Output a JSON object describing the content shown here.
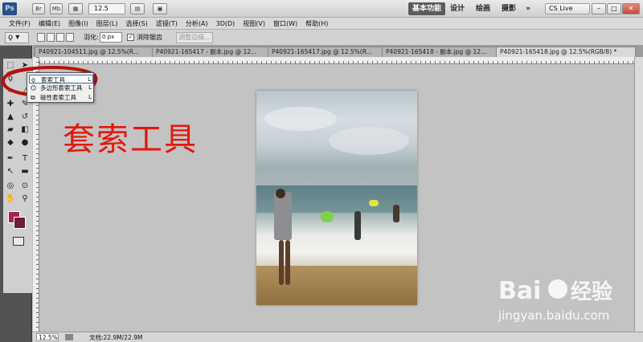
{
  "app": {
    "logo": "Ps",
    "topbar_buttons": [
      "Br",
      "Mb"
    ],
    "zoom": "12.5",
    "workspaces": [
      "基本功能",
      "设计",
      "绘画",
      "摄影"
    ],
    "more_workspaces": "»",
    "cs_live": "CS Live",
    "window_controls": [
      "–",
      "□",
      "✕"
    ]
  },
  "menus": [
    "文件(F)",
    "编辑(E)",
    "图像(I)",
    "图层(L)",
    "选择(S)",
    "滤镜(T)",
    "分析(A)",
    "3D(D)",
    "视图(V)",
    "窗口(W)",
    "帮助(H)"
  ],
  "options": {
    "feather_label": "羽化:",
    "feather_value": "0 px",
    "antialias_label": "消除锯齿",
    "antialias_checked": "✓",
    "refine_edge": "调整边缘..."
  },
  "tabs": [
    {
      "label": "P40921-104511.jpg @ 12.5%(R..."
    },
    {
      "label": "P40921-165417 - 副本.jpg @ 12..."
    },
    {
      "label": "P40921-165417.jpg @ 12.5%(R..."
    },
    {
      "label": "P40921-165418 - 副本.jpg @ 12..."
    },
    {
      "label": "P40921-165418.jpg @ 12.5%(RGB/8) *"
    }
  ],
  "flyout": [
    {
      "label": "套索工具",
      "key": "L"
    },
    {
      "label": "多边形套索工具",
      "key": "L"
    },
    {
      "label": "磁性套索工具",
      "key": "L"
    }
  ],
  "annotation": "套索工具",
  "status": {
    "zoom": "12.5%",
    "doc": "文档:22.9M/22.9M"
  },
  "watermark": {
    "url": "jingyan.baidu.com"
  },
  "colors": {
    "foreground": "#a4264b",
    "background": "#6b1d3b",
    "annotation": "#e3170d"
  }
}
